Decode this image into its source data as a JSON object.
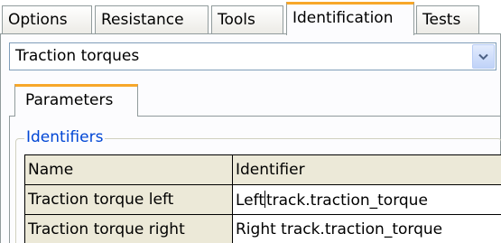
{
  "tabs": [
    {
      "label": "Options",
      "active": false
    },
    {
      "label": "Resistance",
      "active": false
    },
    {
      "label": "Tools",
      "active": false
    },
    {
      "label": "Identification",
      "active": true
    },
    {
      "label": "Tests",
      "active": false
    }
  ],
  "combo": {
    "selected": "Traction torques"
  },
  "inner_tabs": [
    {
      "label": "Parameters",
      "active": true
    }
  ],
  "identifiers": {
    "group_label": "Identifiers",
    "columns": [
      "Name",
      "Identifier"
    ],
    "rows": [
      {
        "name": "Traction torque left",
        "identifier_before_caret": "Left",
        "identifier_after_caret": "track.traction_torque"
      },
      {
        "name": "Traction torque right",
        "identifier": "Right track.traction_torque"
      }
    ]
  },
  "colors": {
    "active_tab_accent": "#f7a72a",
    "group_label": "#0046d5",
    "header_cell_bg": "#ece9d8"
  },
  "icons": {
    "combo_dropdown": "chevron-down-icon"
  }
}
